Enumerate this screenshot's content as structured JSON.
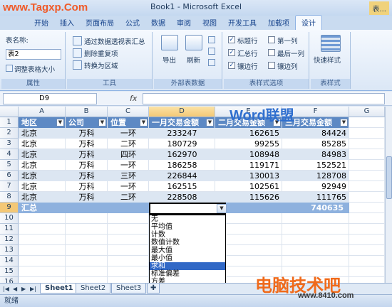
{
  "watermark_top": "www.Tagxp.Com",
  "window_title": "Book1 - Microsoft Excel",
  "context_tab": "表...",
  "tabs": [
    "开始",
    "插入",
    "页面布局",
    "公式",
    "数据",
    "审阅",
    "视图",
    "开发工具",
    "加载项",
    "设计"
  ],
  "ribbon": {
    "properties": {
      "title": "属性",
      "table_name_label": "表名称:",
      "table_name_value": "表2",
      "resize_label": "调整表格大小"
    },
    "tools": {
      "title": "工具",
      "items": [
        "通过数据透视表汇总",
        "删除重复项",
        "转换为区域"
      ]
    },
    "external": {
      "title": "外部表数据",
      "export_label": "导出",
      "refresh_label": "刷新"
    },
    "style_options": {
      "title": "表样式选项",
      "options": [
        {
          "label": "标题行",
          "checked": true
        },
        {
          "label": "第一列",
          "checked": false
        },
        {
          "label": "汇总行",
          "checked": true
        },
        {
          "label": "最后一列",
          "checked": false
        },
        {
          "label": "镶边行",
          "checked": true
        },
        {
          "label": "镶边列",
          "checked": false
        }
      ]
    },
    "table_styles": {
      "title": "表样式",
      "quick_styles_label": "快速样式"
    }
  },
  "formula_bar": {
    "name_box": "D9",
    "fx": "fx",
    "content": ""
  },
  "watermark_word": "Word联盟",
  "columns": [
    "A",
    "B",
    "C",
    "D",
    "E",
    "F",
    "G"
  ],
  "rows": [
    "1",
    "2",
    "3",
    "4",
    "5",
    "6",
    "7",
    "8",
    "9",
    "10",
    "11",
    "12",
    "13",
    "14",
    "15",
    "16",
    "17"
  ],
  "table": {
    "headers": [
      "地区",
      "公司",
      "位置",
      "一月交易金额",
      "二月交易金额",
      "三月交易金额"
    ],
    "data": [
      [
        "北京",
        "万科",
        "一环",
        "233247",
        "162615",
        "84424"
      ],
      [
        "北京",
        "万科",
        "二环",
        "180729",
        "99255",
        "85285"
      ],
      [
        "北京",
        "万科",
        "四环",
        "162970",
        "108948",
        "84983"
      ],
      [
        "北京",
        "万科",
        "一环",
        "186258",
        "119171",
        "152521"
      ],
      [
        "北京",
        "万科",
        "三环",
        "226844",
        "130013",
        "128708"
      ],
      [
        "北京",
        "万科",
        "一环",
        "162515",
        "102561",
        "92949"
      ],
      [
        "北京",
        "万科",
        "二环",
        "228508",
        "115626",
        "111765"
      ]
    ],
    "total_label": "汇总",
    "total_value": "740635"
  },
  "dropdown": {
    "options": [
      "无",
      "平均值",
      "计数",
      "数值计数",
      "最大值",
      "最小值",
      "求和",
      "标准偏差",
      "方差",
      "其他函数..."
    ],
    "selected_index": 6
  },
  "sheet_tabs": [
    "Sheet1",
    "Sheet2",
    "Sheet3"
  ],
  "active_sheet": 0,
  "status": "就绪",
  "watermark_bottom": "电脑技术吧",
  "watermark_bottom_url": "www.8410.com"
}
